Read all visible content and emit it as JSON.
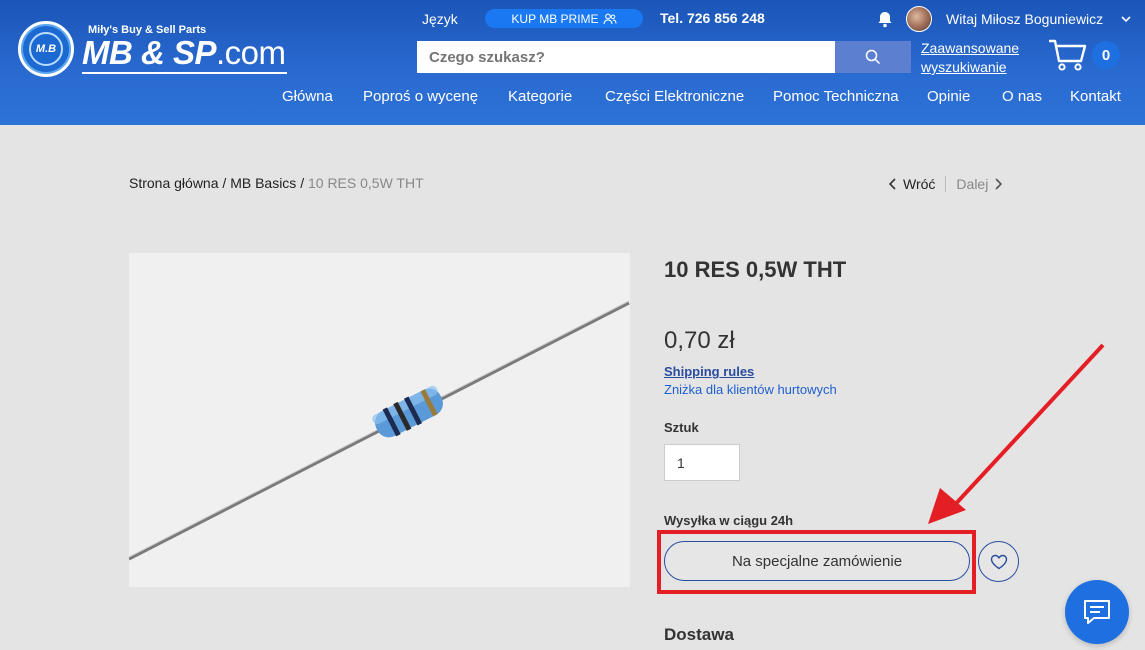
{
  "header": {
    "logo": {
      "tagline": "Miły's Buy & Sell Parts",
      "name": "MB & SP",
      "suffix": ".com",
      "badge": "M.B"
    },
    "language_label": "Język",
    "prime_button": "KUP MB PRIME",
    "phone": "Tel. 726 856 248",
    "greeting": "Witaj Miłosz Boguniewicz",
    "search": {
      "placeholder": "Czego szukasz?"
    },
    "advanced_search": "Zaawansowane wyszukiwanie",
    "cart_count": "0",
    "nav": [
      "Główna",
      "Poproś o wycenę",
      "Kategorie",
      "Części Elektroniczne",
      "Pomoc Techniczna",
      "Opinie",
      "O nas",
      "Kontakt"
    ]
  },
  "breadcrumb": {
    "items": [
      "Strona główna",
      "MB Basics",
      "10 RES 0,5W THT"
    ],
    "separator": "/"
  },
  "pager": {
    "prev": "Wróć",
    "next": "Dalej"
  },
  "product": {
    "title": "10 RES 0,5W THT",
    "price": "0,70 zł",
    "shipping_rules": "Shipping rules",
    "discount": "Zniżka dla klientów hurtowych",
    "quantity_label": "Sztuk",
    "quantity_value": "1",
    "shipping_time": "Wysyłka w ciągu 24h",
    "order_button": "Na specjalne zamówienie",
    "delivery_heading": "Dostawa"
  },
  "colors": {
    "header_blue": "#2a6bd1",
    "accent_blue": "#1e6fe0",
    "highlight_red": "#e31e24",
    "page_bg": "#e5e4e4"
  }
}
